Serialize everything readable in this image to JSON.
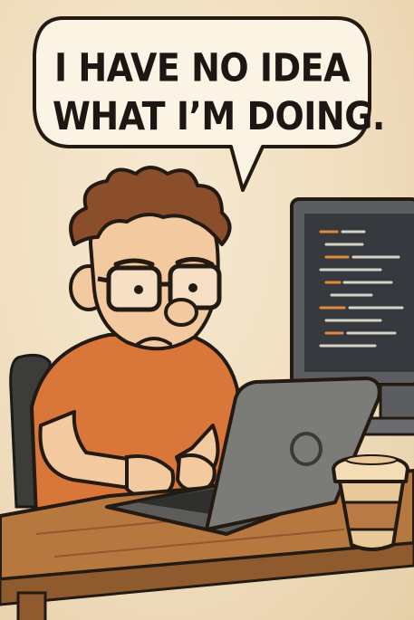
{
  "speech_bubble": {
    "line1": "I HAVE NO IDEA",
    "line2": "WHAT I’M DOING."
  },
  "colors": {
    "background": "#f0dfc0",
    "outline": "#231a12",
    "shirt": "#d9773a",
    "skin": "#f3c9a0",
    "hair": "#8a4f2a",
    "desk": "#b7783f",
    "laptop": "#7b7b78",
    "monitor_screen": "#3a3d42",
    "coffee_cup": "#e9c89a",
    "coffee_sleeve": "#b97a45"
  },
  "icons": [
    "speech-bubble",
    "laptop-logo",
    "code-lines"
  ]
}
